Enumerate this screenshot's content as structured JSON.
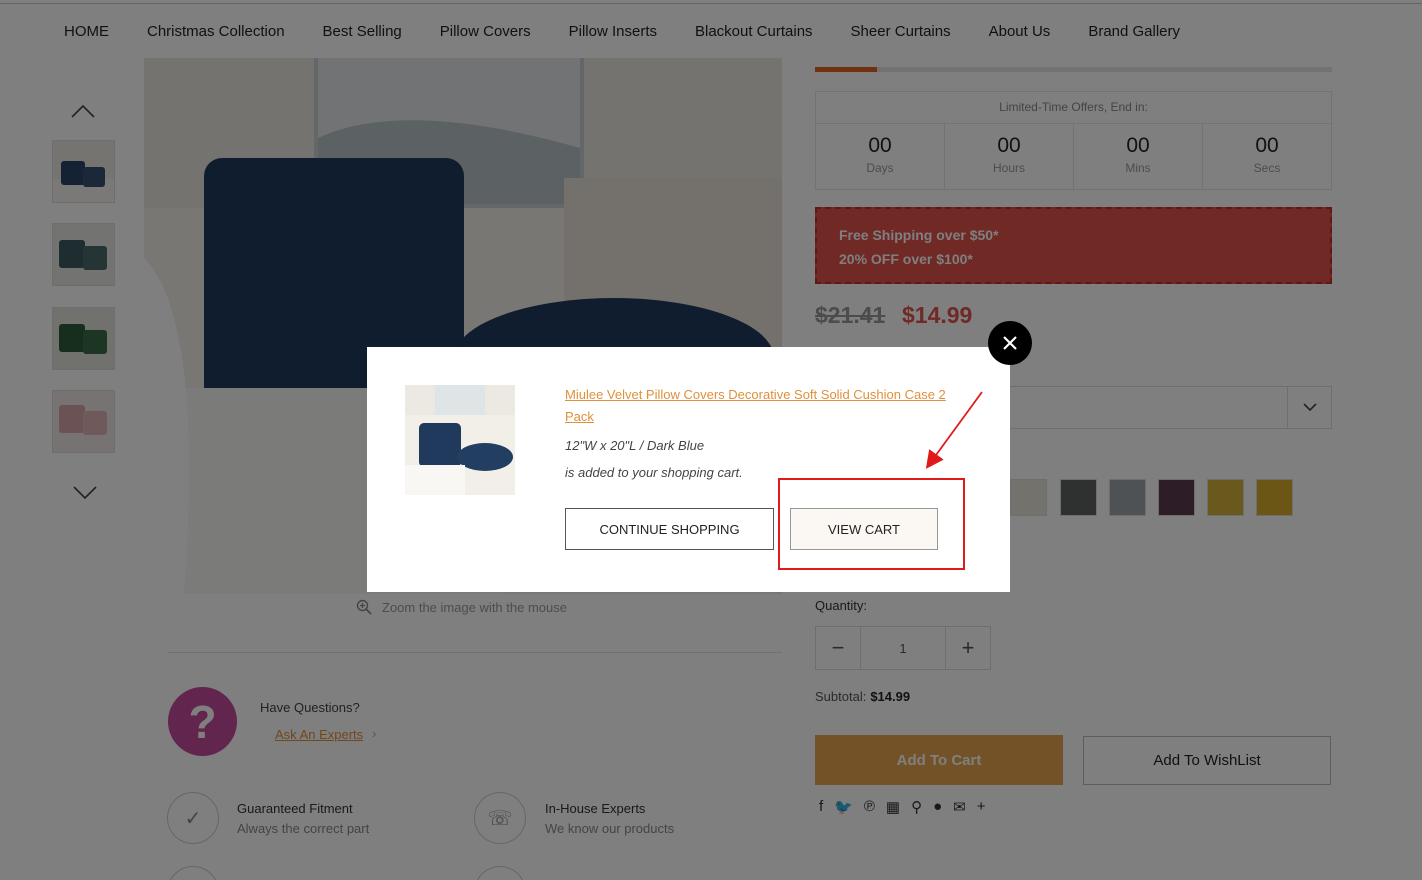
{
  "nav": {
    "items": [
      "HOME",
      "Christmas Collection",
      "Best Selling",
      "Pillow Covers",
      "Pillow Inserts",
      "Blackout Curtains",
      "Sheer Curtains",
      "About Us",
      "Brand Gallery"
    ]
  },
  "gallery": {
    "zoom_note": "Zoom the image with the mouse"
  },
  "help": {
    "have_questions": "Have Questions?",
    "ask_link": "Ask An Experts"
  },
  "features": [
    {
      "title": "Guaranteed Fitment",
      "sub": "Always the correct part"
    },
    {
      "title": "In-House Experts",
      "sub": "We know our products"
    }
  ],
  "countdown": {
    "label": "Limited-Time Offers, End in:",
    "days": "00",
    "days_label": "Days",
    "hours": "00",
    "hours_label": "Hours",
    "mins": "00",
    "mins_label": "Mins",
    "secs": "00",
    "secs_label": "Secs"
  },
  "promo": {
    "line1": "Free Shipping over $50*",
    "line2": "20% OFF over $100*"
  },
  "price": {
    "old": "$21.41",
    "new": "$14.99"
  },
  "quantity": {
    "label": "Quantity:",
    "value": "1",
    "minus": "−",
    "plus": "+"
  },
  "subtotal": {
    "label": "Subtotal:",
    "value": "$14.99"
  },
  "actions": {
    "add_to_cart": "Add To Cart",
    "add_to_wishlist": "Add To WishList"
  },
  "share_icons": [
    "facebook-icon",
    "twitter-icon",
    "pinterest-icon",
    "grid-icon",
    "pin-icon",
    "reddit-icon",
    "email-icon",
    "plus-icon"
  ],
  "modal": {
    "product_title": "Miulee Velvet Pillow Covers Decorative Soft Solid Cushion Case 2 Pack",
    "variant": "12\"W x 20\"L / Dark Blue",
    "added_text": "is added to your shopping cart.",
    "continue_label": "CONTINUE SHOPPING",
    "view_cart_label": "VIEW CART"
  },
  "colors": {
    "accent_orange": "#e0903a",
    "promo_red": "#e0524a",
    "highlight_red": "#e01a1a",
    "add_to_cart": "#e8a451",
    "help_purple": "#c24a9c"
  }
}
